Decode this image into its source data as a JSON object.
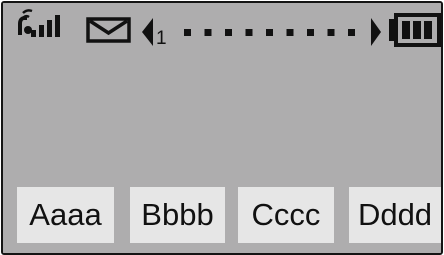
{
  "colors": {
    "screen_bg": "#aeadae",
    "softkey_bg": "#e6e6e6",
    "ink": "#111111"
  },
  "status_bar": {
    "signal_icon": "antenna-signal-icon",
    "message_icon": "envelope-icon",
    "page_indicator": {
      "current_page_label": "1",
      "current_page": 1,
      "total_pages": 10
    },
    "battery_icon": "battery-icon",
    "battery_level_bars": 3
  },
  "softkeys": [
    {
      "label": "Aaaa"
    },
    {
      "label": "Bbbb"
    },
    {
      "label": "Cccc"
    },
    {
      "label": "Dddd"
    }
  ]
}
